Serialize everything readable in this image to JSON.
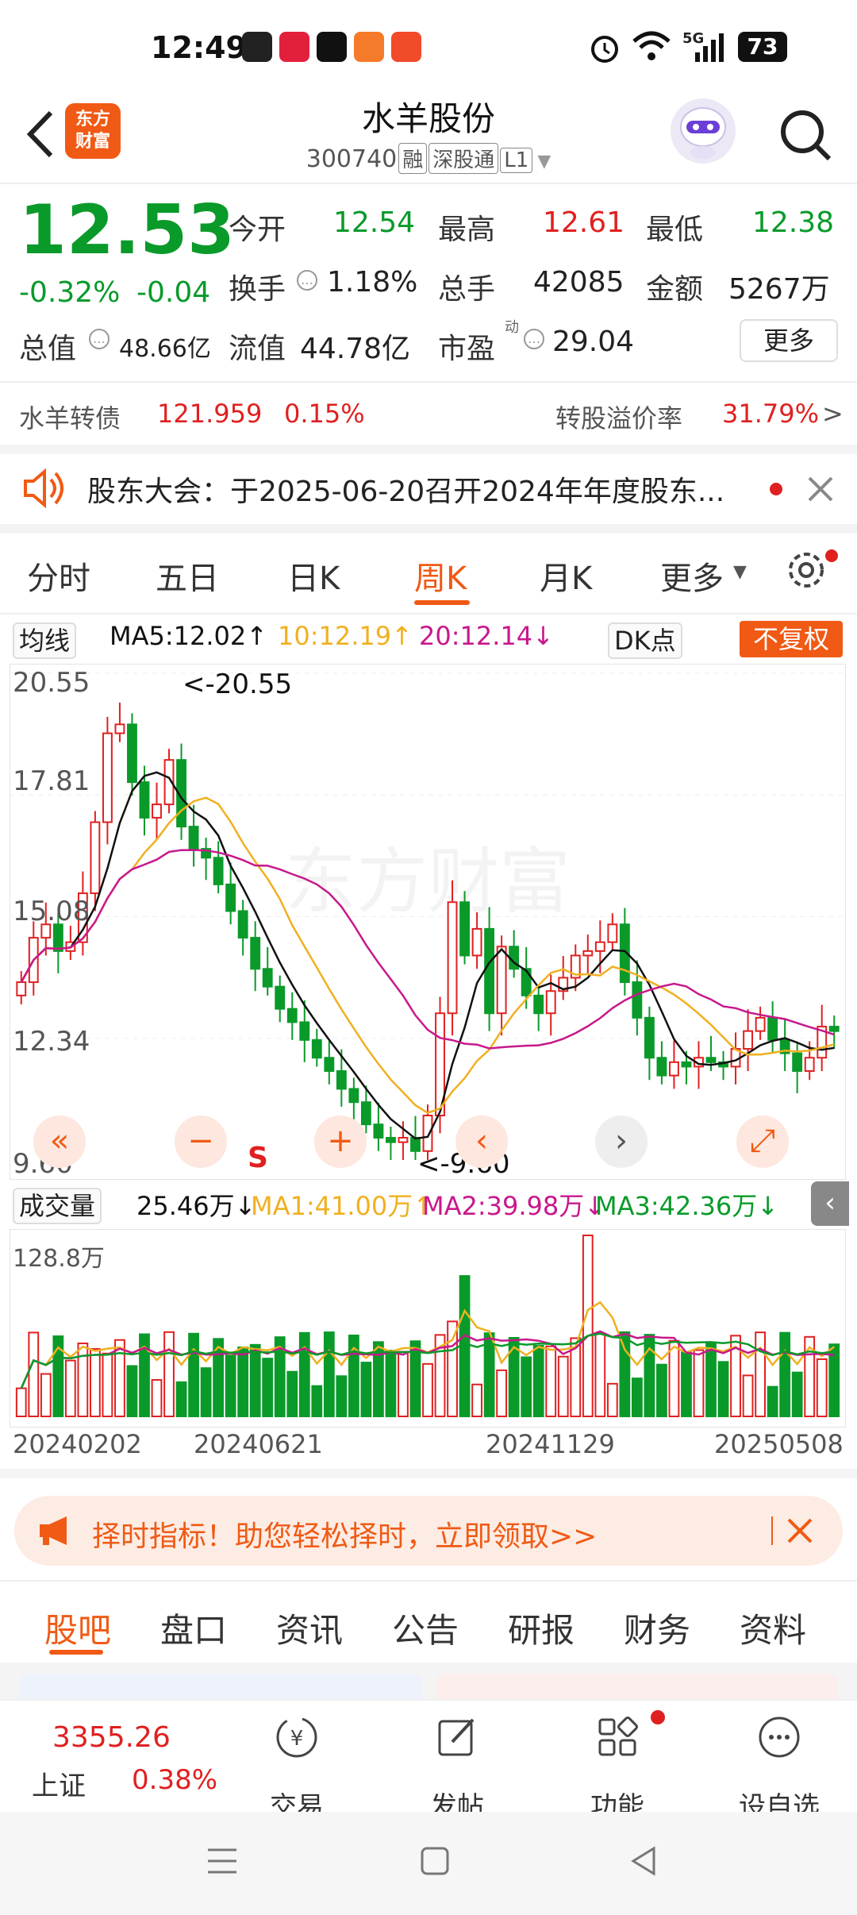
{
  "status_bar": {
    "time": "12:49",
    "battery": "73",
    "signal_label": "5G"
  },
  "header": {
    "title": "水羊股份",
    "code": "300740",
    "tags": [
      "融",
      "深股通",
      "L1"
    ],
    "logo_text": "东方财富"
  },
  "quote": {
    "price": "12.53",
    "change_pct": "-0.32%",
    "change": "-0.04",
    "fields": {
      "open_label": "今开",
      "open": "12.54",
      "high_label": "最高",
      "high": "12.61",
      "low_label": "最低",
      "low": "12.38",
      "turnover_label": "换手",
      "turnover": "1.18%",
      "volume_label": "总手",
      "volume": "42085",
      "amount_label": "金额",
      "amount": "5267万",
      "mktcap_label": "总值",
      "mktcap": "48.66亿",
      "float_label": "流值",
      "float": "44.78亿",
      "pe_label": "市盈",
      "pe_sup": "动",
      "pe": "29.04"
    },
    "more_label": "更多"
  },
  "bond": {
    "name": "水羊转债",
    "price": "121.959",
    "change": "0.15%",
    "premium_label": "转股溢价率",
    "premium": "31.79%"
  },
  "notice": {
    "text": "股东大会：于2025-06-20召开2024年年度股东..."
  },
  "chart_tabs": [
    "分时",
    "五日",
    "日K",
    "周K",
    "月K",
    "更多"
  ],
  "ma_row": {
    "select": "均线",
    "ma5": "MA5:12.02",
    "ma10": "10:12.19",
    "ma20": "20:12.14",
    "dk": "DK点",
    "unadjusted": "不复权"
  },
  "price_axis": [
    "20.55",
    "17.81",
    "15.08",
    "12.34",
    "9.60"
  ],
  "annotations": {
    "high": "<-20.55",
    "low": "<-9.60",
    "signal": "S"
  },
  "volume_row": {
    "select": "成交量",
    "vol": "25.46万",
    "ma1": "MA1:41.00万",
    "ma2": "MA2:39.98万",
    "ma3": "MA3:42.36万",
    "max": "128.8万"
  },
  "dates": [
    "20240202",
    "20240621",
    "20241129",
    "20250508"
  ],
  "banner": {
    "text": "择时指标！助您轻松择时，立即领取>>"
  },
  "bottom_tabs": [
    "股吧",
    "盘口",
    "资讯",
    "公告",
    "研报",
    "财务",
    "资料"
  ],
  "footer": {
    "index_value": "3355.26",
    "index_name": "上证",
    "index_change": "0.38%",
    "items": [
      "交易",
      "发帖",
      "功能",
      "设自选"
    ]
  },
  "colors": {
    "accent": "#f05a14",
    "up": "#e02020",
    "down": "#0a9a2a",
    "ma5": "#111111",
    "ma10": "#f0b020",
    "ma20": "#c8188c"
  },
  "chart_data": {
    "type": "candlestick",
    "ylim": [
      9.6,
      20.55
    ],
    "high": 20.55,
    "low": 9.6,
    "ma5": 12.02,
    "ma10": 12.19,
    "ma20": 12.14,
    "x_ticks": [
      "20240202",
      "20240621",
      "20241129",
      "20250508"
    ],
    "weekly_close": [
      13.6,
      14.6,
      14.9,
      14.3,
      14.5,
      15.6,
      17.2,
      19.2,
      19.4,
      18.1,
      17.3,
      17.6,
      18.6,
      17.1,
      16.6,
      16.4,
      15.8,
      15.2,
      14.6,
      13.9,
      13.5,
      13.0,
      12.7,
      12.3,
      11.9,
      11.6,
      11.2,
      10.9,
      10.4,
      10.1,
      10.0,
      10.1,
      9.8,
      10.6,
      12.9,
      15.4,
      14.2,
      14.8,
      12.9,
      14.4,
      13.9,
      13.3,
      12.9,
      13.4,
      13.7,
      14.2,
      14.3,
      14.5,
      14.9,
      13.6,
      12.8,
      11.9,
      11.5,
      11.8,
      11.7,
      11.9,
      11.8,
      11.7,
      12.1,
      12.5,
      12.8,
      12.3,
      12.0,
      11.6,
      11.9,
      12.6,
      12.5
    ],
    "volume_series": [
      {
        "name": "MA1",
        "value": 41.0
      },
      {
        "name": "MA2",
        "value": 39.98
      },
      {
        "name": "MA3",
        "value": 42.36
      }
    ],
    "volume_max": 128.8,
    "volume_last": 25.46
  }
}
